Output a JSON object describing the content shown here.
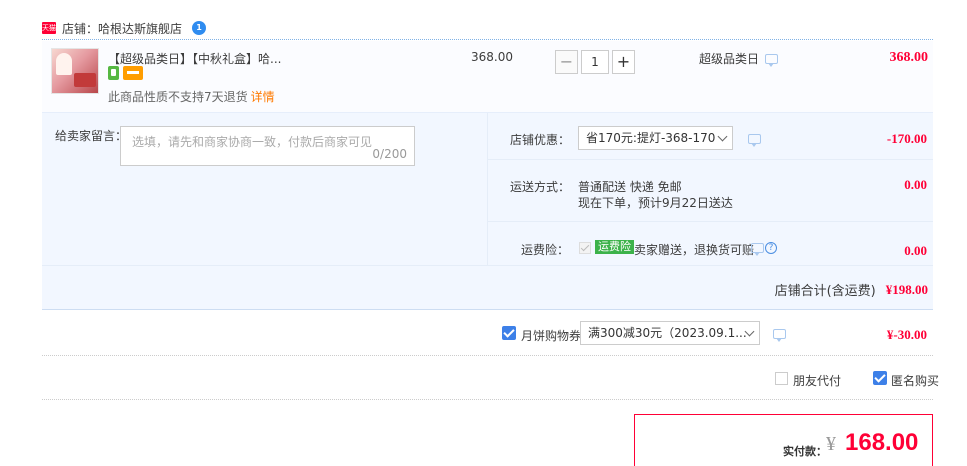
{
  "shop": {
    "badge": "天猫",
    "label": "店铺：哈根达斯旗舰店"
  },
  "item": {
    "title": "【超级品类日】【中秋礼盒】哈...",
    "note": "此商品性质不支持7天退货",
    "detail_link": "详情",
    "unit_price": "368.00",
    "quantity": "1",
    "minus": "−",
    "plus": "+",
    "promo": "超级品类日",
    "total": "368.00"
  },
  "memo": {
    "label": "给卖家留言：",
    "placeholder": "选填，请先和商家协商一致，付款后商家可见",
    "count": "0/200"
  },
  "discount": {
    "label": "店铺优惠：",
    "selected": "省170元:提灯-368-170",
    "amount": "-170.00"
  },
  "delivery": {
    "label": "运送方式：",
    "method": "普通配送 快递 免邮",
    "eta": "现在下单，预计9月22日送达",
    "amount": "0.00"
  },
  "insurance": {
    "label": "运费险：",
    "tag": "运费险",
    "desc": "卖家赠送，退换货可赔",
    "help": "?",
    "amount": "0.00"
  },
  "shop_total": {
    "label": "店铺合计(含运费)",
    "amount": "¥198.00"
  },
  "coupon": {
    "label": "月饼购物券",
    "selected": "满300减30元（2023.09.1...",
    "amount": "¥-30.00"
  },
  "options": {
    "friend_pay": "朋友代付",
    "anonymous": "匿名购买"
  },
  "payment": {
    "label": "实付款：",
    "currency": "¥",
    "amount": "168.00"
  },
  "colors": {
    "price_red": "#ff0036",
    "checkbox_blue": "#3d80e8",
    "panel_bg": "#f2f7ff",
    "insurance_green": "#3cb24a"
  }
}
